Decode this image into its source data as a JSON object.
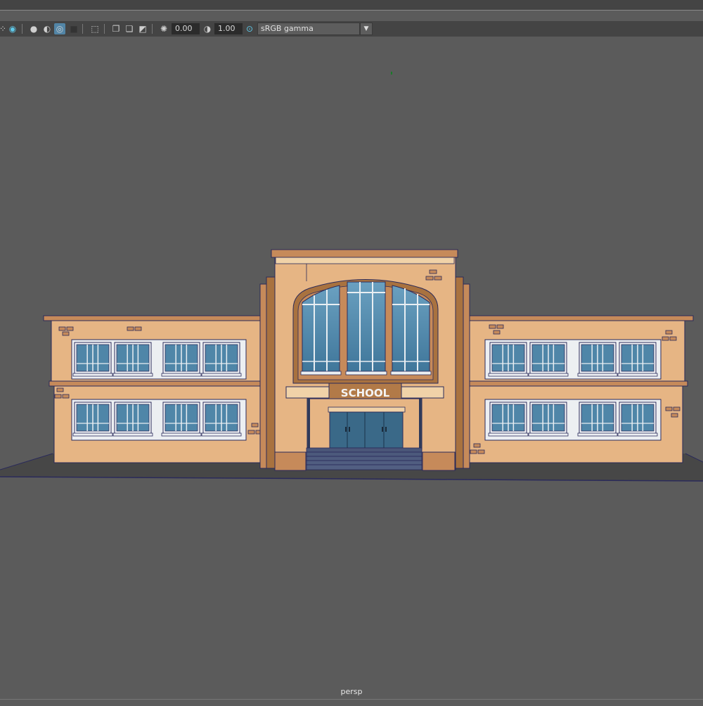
{
  "toolbar": {
    "exposure_value": "0.00",
    "gamma_value": "1.00",
    "color_space": "sRGB gamma",
    "icons": [
      "snap-icon",
      "xray-icon",
      "shaded-sphere-icon",
      "wireframe-sphere-icon",
      "isolate-icon",
      "grid-icon",
      "select-camera-icon",
      "copy-icon",
      "paste-icon",
      "resolution-gate-icon",
      "exposure-icon",
      "gamma-icon",
      "color-management-icon"
    ]
  },
  "scene": {
    "sign_text": "SCHOOL",
    "colors": {
      "wall": "#e6b584",
      "trim": "#c68a5a",
      "dark_trim": "#a9723f",
      "glass": "#4f86a8",
      "door": "#3a6988",
      "outline": "#2a2a5a",
      "ground": "#4a4a4a"
    }
  },
  "viewport": {
    "camera_label": "persp"
  }
}
